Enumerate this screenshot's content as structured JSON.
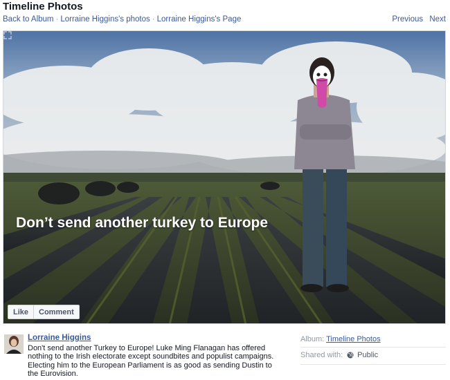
{
  "header": {
    "title": "Timeline Photos",
    "back_to_album": "Back to Album",
    "owner_photos": "Lorraine Higgins's photos",
    "owner_page": "Lorraine Higgins's Page",
    "separator": "·",
    "previous": "Previous",
    "next": "Next"
  },
  "photo": {
    "caption": "Don’t send another turkey to Europe",
    "like_label": "Like",
    "comment_label": "Comment"
  },
  "post": {
    "author": "Lorraine Higgins",
    "text": "Don't send another Turkey to Europe! Luke Ming Flanagan has offered nothing to the Irish electorate except soundbites and populist campaigns. Electing him to the European Parliament is as good as sending Dustin to the Eurovision."
  },
  "meta": {
    "album_label": "Album:",
    "album_name": "Timeline Photos",
    "shared_label": "Shared with:",
    "privacy": "Public"
  },
  "icons": {
    "expand": "expand-icon",
    "globe": "globe-icon"
  },
  "colors": {
    "link": "#3b5998",
    "muted": "#9197a3"
  }
}
